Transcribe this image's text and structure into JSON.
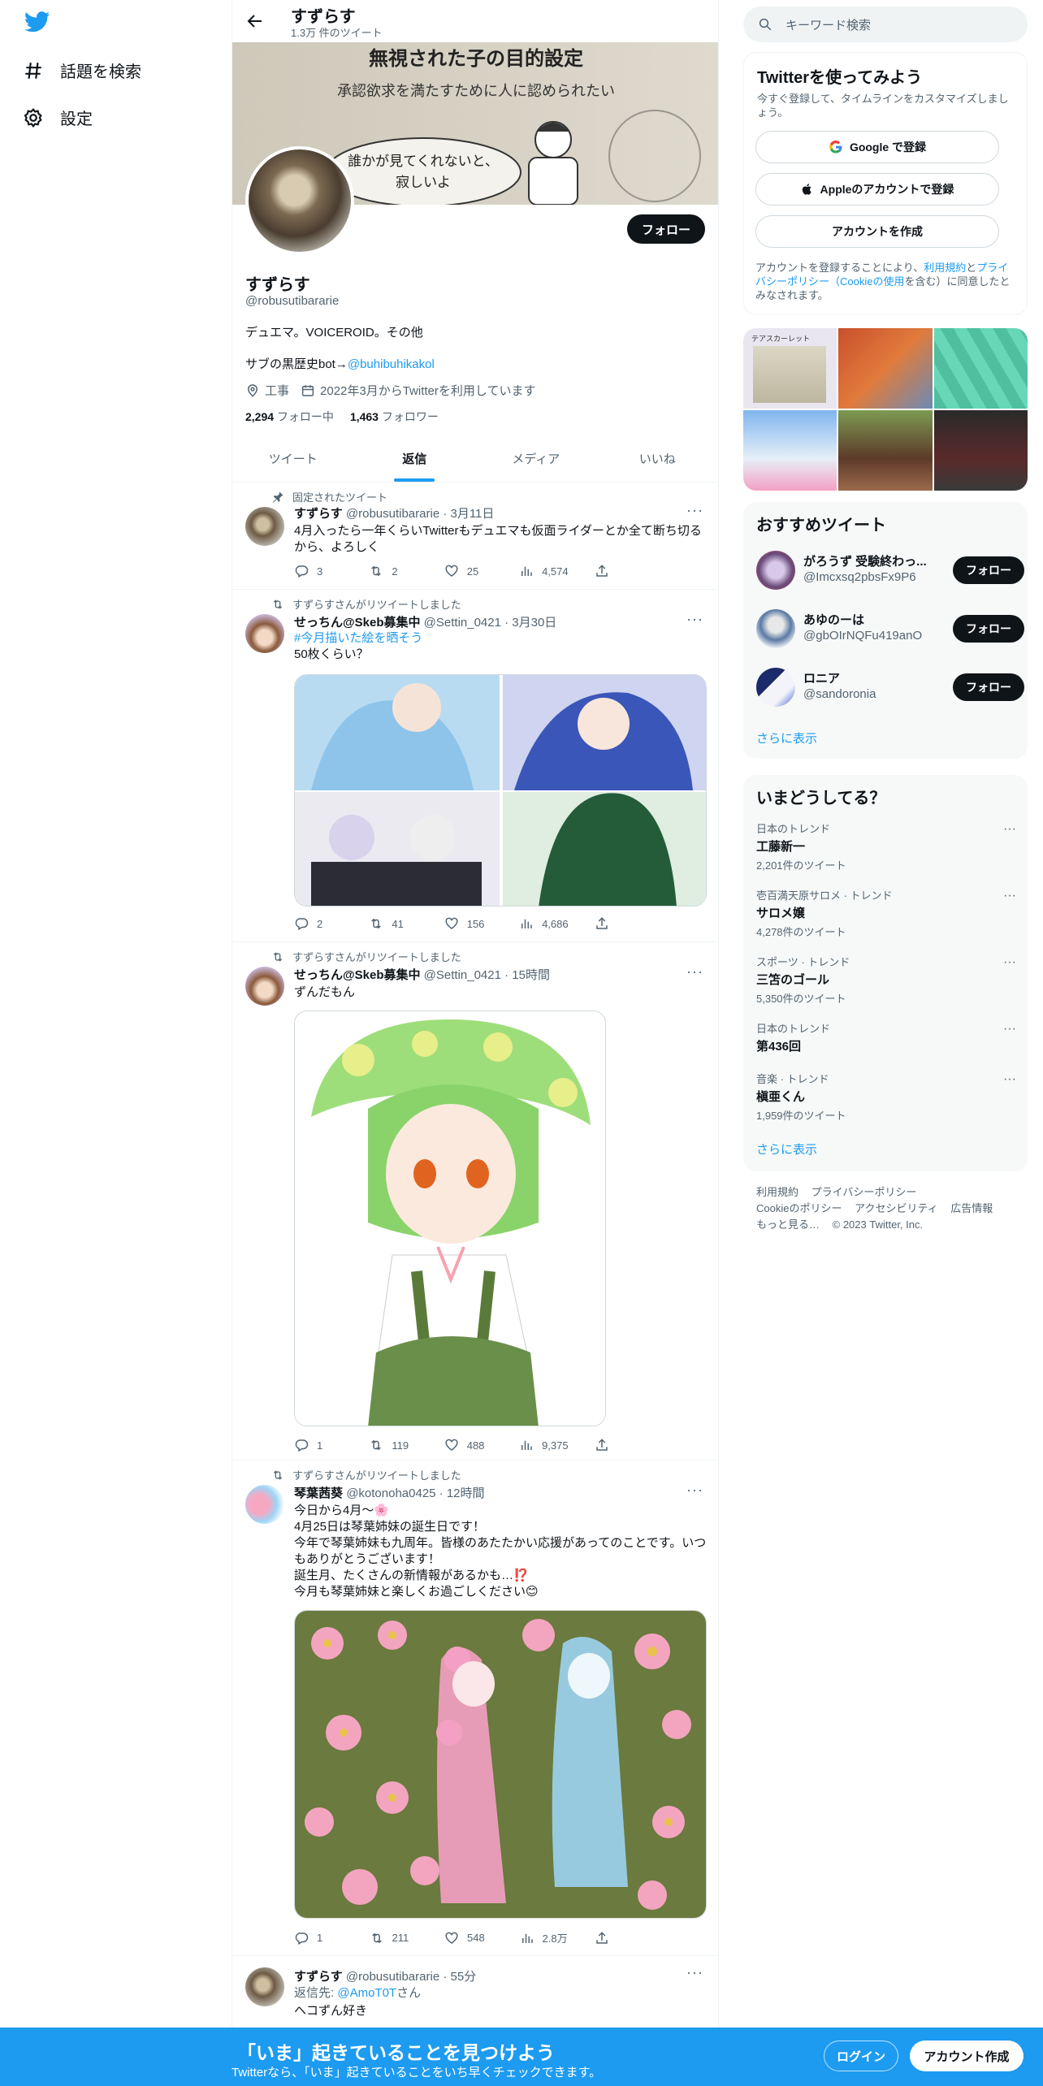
{
  "nav": {
    "explore_label": "話題を検索",
    "settings_label": "設定"
  },
  "header": {
    "title": "すずらす",
    "tweet_count": "1.3万 件のツイート"
  },
  "banner": {
    "line1": "無視された子の目的設定",
    "line2": "承認欲求を満たすために人に認められたい",
    "bubble": "誰かが見てくれないと、寂しいよ"
  },
  "profile": {
    "name": "すずらす",
    "handle": "@robusutibararie",
    "follow_label": "フォロー",
    "bio": "デュエマ。VOICEROID。その他",
    "bio2_prefix": "サブの黒歴史bot→",
    "bio2_link": "@buhibuhikakol",
    "location": "工事",
    "joined": "2022年3月からTwitterを利用しています",
    "following_count": "2,294",
    "following_label": "フォロー中",
    "followers_count": "1,463",
    "followers_label": "フォロワー"
  },
  "tabs": [
    {
      "label": "ツイート"
    },
    {
      "label": "返信"
    },
    {
      "label": "メディア"
    },
    {
      "label": "いいね"
    }
  ],
  "tweets": [
    {
      "context": "固定されたツイート",
      "name": "すずらす",
      "meta": "@robusutibararie · 3月11日",
      "text": "4月入ったら一年くらいTwitterもデュエマも仮面ライダーとか全て断ち切るから、よろしく",
      "replies": "3",
      "retweets": "2",
      "likes": "25",
      "views": "4,574"
    },
    {
      "context": "すずらすさんがリツイートしました",
      "name": "せっちん@Skeb募集中",
      "meta": "@Settin_0421 · 3月30日",
      "hashtag": "#今月描いた絵を晒そう",
      "text": "50枚くらい？",
      "replies": "2",
      "retweets": "41",
      "likes": "156",
      "views": "4,686"
    },
    {
      "context": "すずらすさんがリツイートしました",
      "name": "せっちん@Skeb募集中",
      "meta": "@Settin_0421 · 15時間",
      "text": "ずんだもん",
      "replies": "1",
      "retweets": "119",
      "likes": "488",
      "views": "9,375"
    },
    {
      "context": "すずらすさんがリツイートしました",
      "name": "琴葉茜葵",
      "meta": "@kotonoha0425 · 12時間",
      "text_lines": [
        "今日から4月～🌸",
        "4月25日は琴葉姉妹の誕生日です！",
        "今年で琴葉姉妹も九周年。皆様のあたたかい応援があってのことです。いつもありがとうございます！",
        "誕生月、たくさんの新情報があるかも…⁉️",
        "今月も琴葉姉妹と楽しくお過ごしください😊"
      ],
      "replies": "1",
      "retweets": "211",
      "likes": "548",
      "views": "2.8万"
    },
    {
      "name": "すずらす",
      "meta": "@robusutibararie · 55分",
      "reply_prefix": "返信先: ",
      "reply_to": "@AmoT0T",
      "reply_suffix": "さん",
      "text": "ヘコずん好き"
    }
  ],
  "right": {
    "search_placeholder": "キーワード検索",
    "signup_title": "Twitterを使ってみよう",
    "signup_sub": "今すぐ登録して、タイムラインをカスタマイズしましょう。",
    "google_btn": "Google で登録",
    "apple_btn": "Appleのアカウントで登録",
    "create_btn": "アカウントを作成",
    "terms_prefix": "アカウントを登録することにより、",
    "terms_link1": "利用規約",
    "terms_mid": "と",
    "terms_link2": "プライバシーポリシー（Cookieの使用",
    "terms_suffix": "を含む）に同意したとみなされます。",
    "media_thumb_text": "テアスカーレット",
    "rec_title": "おすすめツイート",
    "recommendations": [
      {
        "name": "がろうず 受験終わっ...",
        "handle": "@Imcxsq2pbsFx9P6",
        "btn": "フォロー"
      },
      {
        "name": "あゆのーは",
        "handle": "@gbOIrNQFu419anO",
        "btn": "フォロー"
      },
      {
        "name": "ロニア",
        "handle": "@sandoronia",
        "btn": "フォロー"
      }
    ],
    "show_more": "さらに表示",
    "trends_title": "いまどうしてる？",
    "trends": [
      {
        "context": "日本のトレンド",
        "name": "工藤新一",
        "count": "2,201件のツイート"
      },
      {
        "context": "壱百満天原サロメ · トレンド",
        "name": "サロメ嬢",
        "count": "4,278件のツイート"
      },
      {
        "context": "スポーツ · トレンド",
        "name": "三笘のゴール",
        "count": "5,350件のツイート"
      },
      {
        "context": "日本のトレンド",
        "name": "第436回",
        "count": ""
      },
      {
        "context": "音楽 · トレンド",
        "name": "槇亜くん",
        "count": "1,959件のツイート"
      }
    ],
    "footer": {
      "terms": "利用規約",
      "privacy": "プライバシーポリシー",
      "cookie": "Cookieのポリシー",
      "accessibility": "アクセシビリティ",
      "ads": "広告情報",
      "more": "もっと見る…",
      "copyright": "© 2023 Twitter, Inc."
    }
  },
  "bottom": {
    "title": "「いま」起きていることを見つけよう",
    "subtitle": "Twitterなら、「いま」起きていることをいち早くチェックできます。",
    "login": "ログイン",
    "signup": "アカウント作成"
  },
  "colors": {
    "accent": "#1d9bf0",
    "text": "#0f1419",
    "muted": "#536471"
  }
}
